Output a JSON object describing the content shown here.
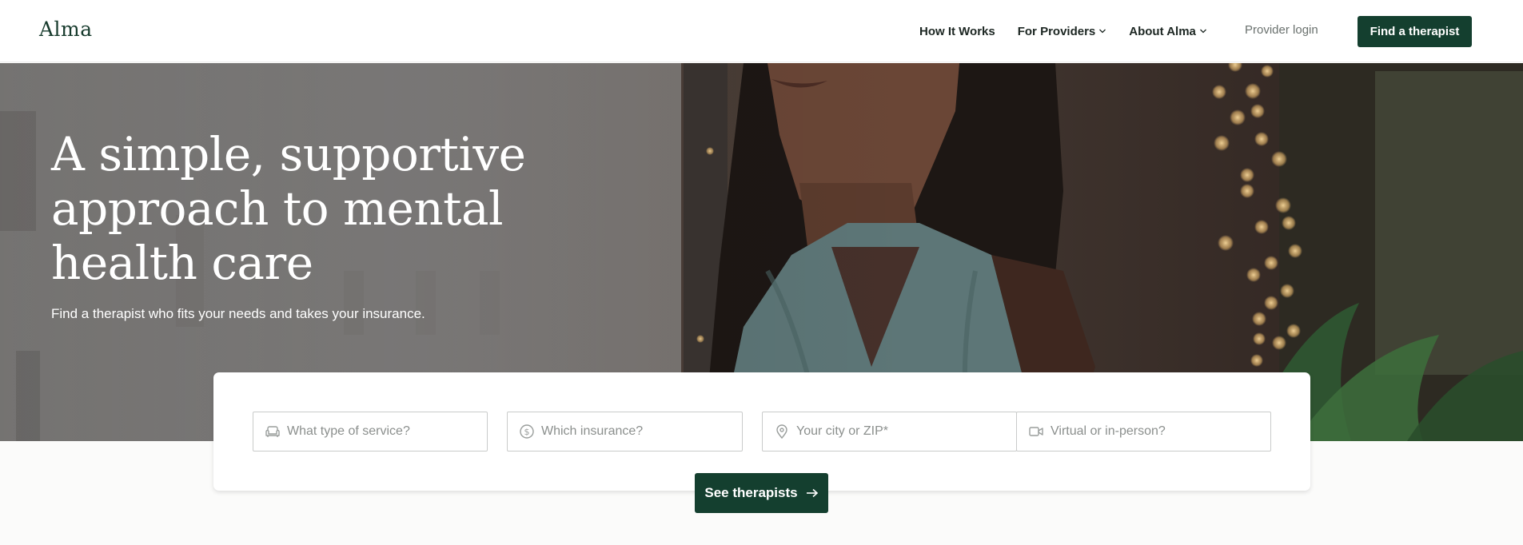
{
  "header": {
    "logo_text": "Alma",
    "nav": [
      {
        "label": "How It Works",
        "has_dropdown": false
      },
      {
        "label": "For Providers",
        "has_dropdown": true
      },
      {
        "label": "About Alma",
        "has_dropdown": true
      }
    ],
    "provider_login": "Provider login",
    "cta_label": "Find a therapist"
  },
  "hero": {
    "title_lines": [
      "A simple, supportive",
      "approach to mental",
      "health care"
    ],
    "subtitle": "Find a therapist who fits your needs and takes your insurance."
  },
  "search": {
    "service": {
      "placeholder": "What type of service?",
      "icon": "couch-icon"
    },
    "insurance": {
      "placeholder": "Which insurance?",
      "icon": "dollar-circle-icon"
    },
    "location": {
      "placeholder": "Your city or ZIP*",
      "icon": "map-pin-icon"
    },
    "format": {
      "placeholder": "Virtual or in-person?",
      "icon": "video-camera-icon"
    },
    "submit_label": "See therapists",
    "submit_icon": "arrow-right-icon"
  },
  "colors": {
    "brand_green": "#143f2f",
    "header_bg": "#ffffff",
    "page_bg": "#fbfbfa"
  }
}
